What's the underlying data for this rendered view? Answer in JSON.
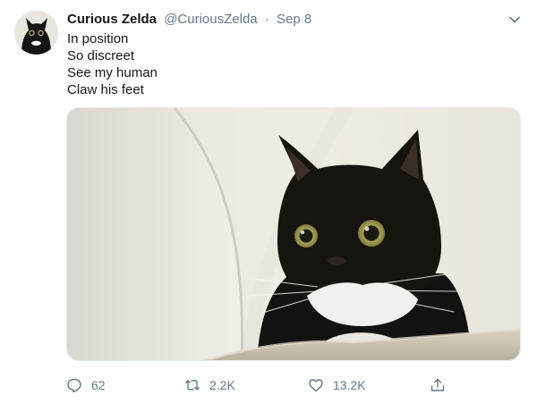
{
  "tweet": {
    "author_name": "Curious Zelda",
    "handle": "@CuriousZelda",
    "separator": "·",
    "date": "Sep 8",
    "text_lines": [
      "In position",
      "So discreet",
      "See my human",
      "Claw his feet"
    ]
  },
  "media": {
    "subject": "tuxedo cat peeking over carpeted stair"
  },
  "actions": {
    "replies": "62",
    "retweets": "2.2K",
    "likes": "13.2K"
  },
  "icons": {
    "menu": "chevron-down-icon",
    "reply": "reply-icon",
    "retweet": "retweet-icon",
    "like": "heart-icon",
    "share": "share-icon"
  },
  "colors": {
    "text": "#14171a",
    "secondary": "#657786",
    "border": "#e1e8ed"
  }
}
